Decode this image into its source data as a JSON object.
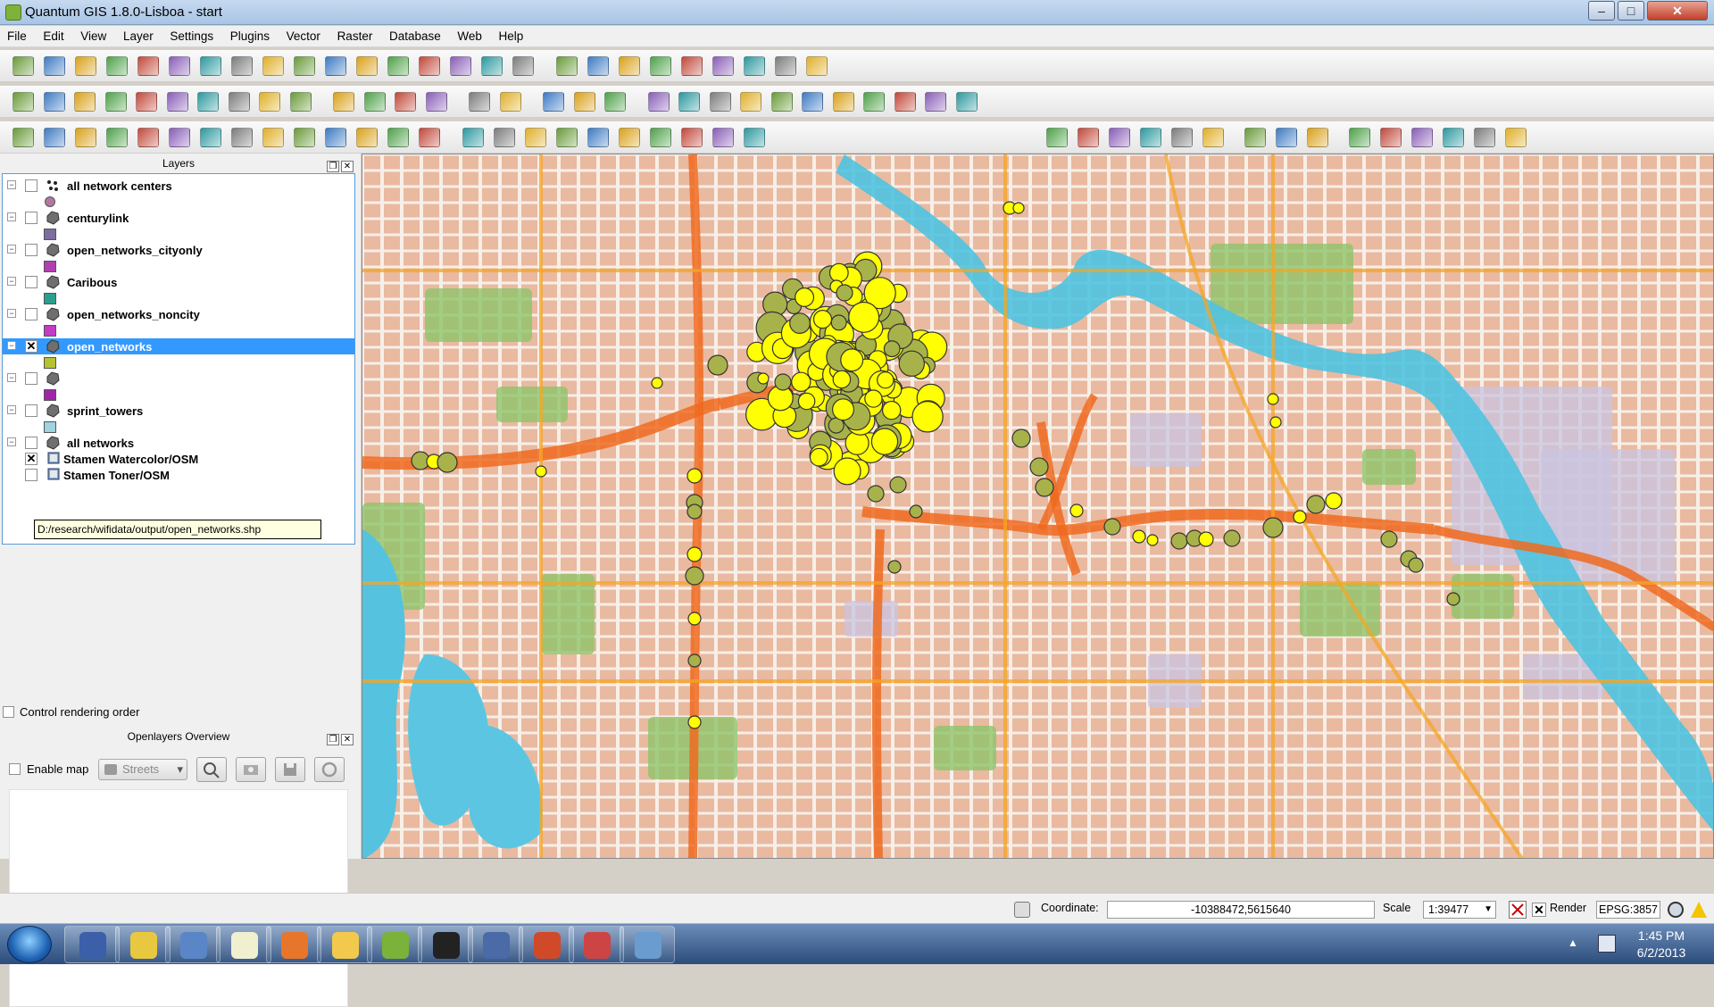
{
  "window": {
    "title": "Quantum GIS 1.8.0-Lisboa - start",
    "min": "–",
    "max": "□",
    "close": "✕"
  },
  "menu": [
    "File",
    "Edit",
    "View",
    "Layer",
    "Settings",
    "Plugins",
    "Vector",
    "Raster",
    "Database",
    "Web",
    "Help"
  ],
  "layers_panel": {
    "title": "Layers",
    "layers": [
      {
        "name": "all network centers",
        "checked": false,
        "swatch": "#b477a4"
      },
      {
        "name": "centurylink",
        "checked": false,
        "swatch": "#7e6ea0"
      },
      {
        "name": "open_networks_cityonly",
        "checked": false,
        "swatch": "#b13fb1"
      },
      {
        "name": "Caribous",
        "checked": false,
        "swatch": "#2a9f8e"
      },
      {
        "name": "open_networks_noncity",
        "checked": false,
        "swatch": "#c53bc5"
      },
      {
        "name": "open_networks",
        "checked": true,
        "swatch": "#b5c232"
      },
      {
        "name": "",
        "checked": false,
        "swatch": "#a026a8"
      },
      {
        "name": "sprint_towers",
        "checked": false,
        "swatch": "#9fd3e0"
      },
      {
        "name": "all networks",
        "checked": false,
        "swatch": ""
      },
      {
        "name": "Stamen Watercolor/OSM",
        "checked": true,
        "swatch": ""
      },
      {
        "name": "Stamen Toner/OSM",
        "checked": false,
        "swatch": ""
      }
    ],
    "tooltip": "D:/research/wifidata/output/open_networks.shp"
  },
  "control_rendering_order": "Control rendering order",
  "overview": {
    "title": "Openlayers Overview",
    "enable_map": "Enable map",
    "layer_select": "Streets"
  },
  "status": {
    "coordinate_label": "Coordinate:",
    "coordinate_value": "-10388472,5615640",
    "scale_label": "Scale",
    "scale_value": "1:39477",
    "render_label": "Render",
    "crs": "EPSG:3857"
  },
  "clock": {
    "time": "1:45 PM",
    "date": "6/2/2013"
  },
  "colors": {
    "selection": "#3399ff",
    "network_point": "#ffff00",
    "network_point_dim": "#a8b24a",
    "water": "#4fc3e0",
    "highway": "#f06a1e"
  },
  "taskbar_apps": [
    "lock-icon",
    "chrome-icon",
    "network-icon",
    "notepad-icon",
    "firefox-icon",
    "folder-icon",
    "qgis-icon",
    "terminal-icon",
    "bridge-icon",
    "office-icon",
    "paint-icon",
    "photo-viewer-icon"
  ]
}
